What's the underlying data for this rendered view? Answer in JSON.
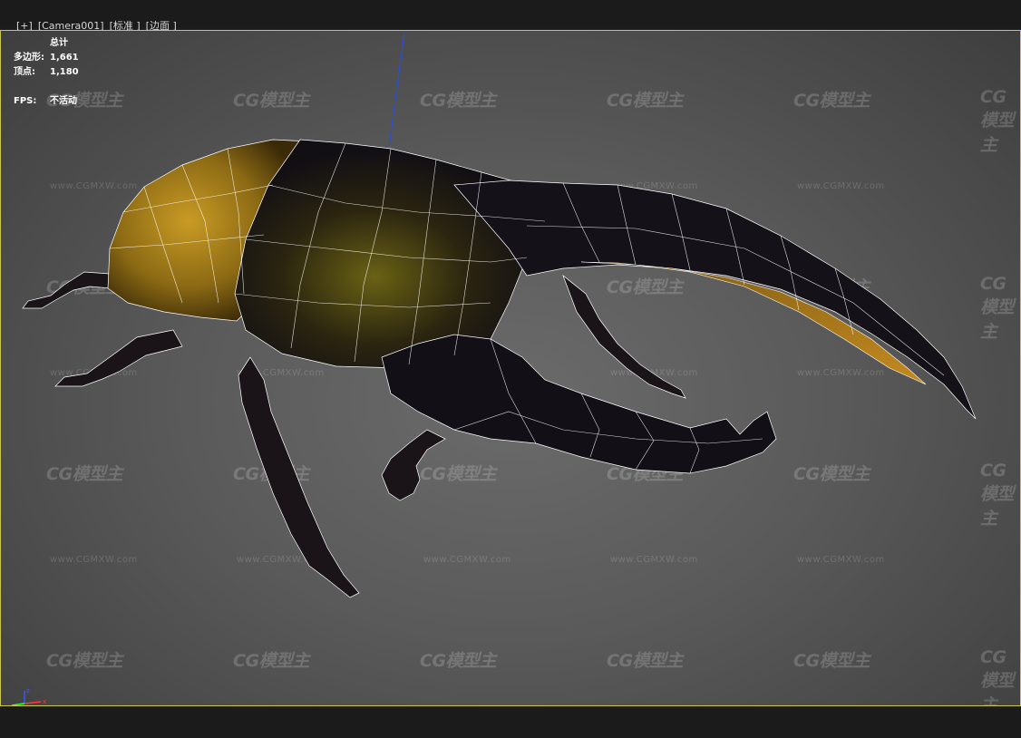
{
  "viewport_label": {
    "items": [
      "[+]",
      "[Camera001]",
      "[标准 ]",
      "[边面 ]"
    ]
  },
  "stats": {
    "header": "总计",
    "polygons_label": "多边形:",
    "polygons_value": "1,661",
    "vertices_label": "顶点:",
    "vertices_value": "1,180",
    "fps_label": "FPS:",
    "fps_value": "不活动"
  },
  "watermark": {
    "logo": "CG模型主",
    "url": "www.CGMXW.com"
  },
  "axis": {
    "z": "z",
    "x": "x",
    "colors": {
      "z": "#3a5bff",
      "x": "#ff3a3a",
      "y": "#3aff3a"
    }
  },
  "colors": {
    "viewport_border": "#c9c64a",
    "wire": "#ffffff",
    "shell_dark": "#17141a",
    "shell_gold": "#b58a1c"
  }
}
